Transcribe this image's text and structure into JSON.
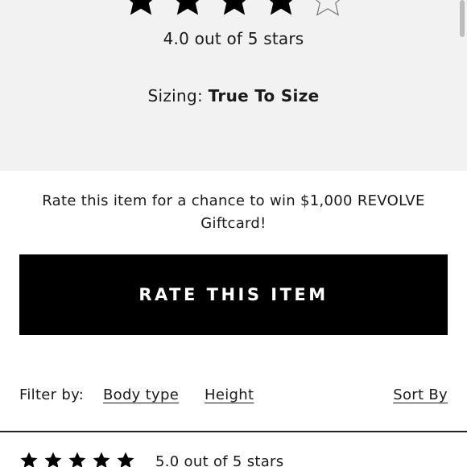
{
  "summary": {
    "stars_filled": 4,
    "stars_total": 5,
    "rating_text": "4.0 out of 5 stars",
    "sizing_label": "Sizing: ",
    "sizing_value": "True To Size"
  },
  "promo": {
    "text": "Rate this item for a chance to win $1,000 REVOLVE Giftcard!"
  },
  "rate_button": {
    "label": "RATE THIS ITEM"
  },
  "filters": {
    "label": "Filter by:",
    "body_type": "Body type",
    "height": "Height",
    "sort_by": "Sort By"
  },
  "review": {
    "stars_filled": 5,
    "stars_total": 5,
    "rating_text": "5.0 out of 5 stars"
  },
  "colors": {
    "summary_bg": "#f2f2f2",
    "button_bg": "#000000",
    "button_text": "#ffffff",
    "star": "#000000"
  }
}
